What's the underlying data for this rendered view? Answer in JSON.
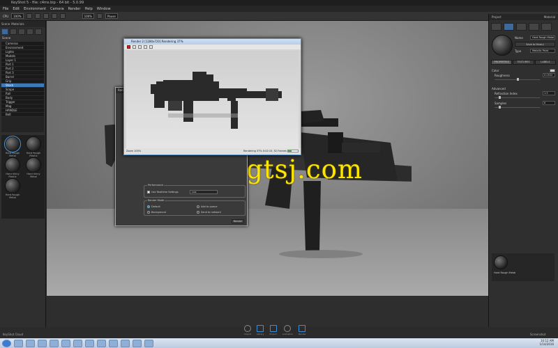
{
  "window": {
    "title": "KeyShot 5 - file: c4ms.bip - 64 bit - 5.0.99"
  },
  "menu": [
    "File",
    "Edit",
    "Environment",
    "Camera",
    "Render",
    "Help",
    "Window"
  ],
  "toolbar": {
    "cpu_label": "CPU",
    "cpu_value": "100%",
    "zoom": "100%",
    "render_mode": "Pause"
  },
  "left_panel": {
    "tabs": [
      "Scene",
      "Materials"
    ],
    "scene_tree_title": "Scene",
    "scene_items": [
      "Cameras",
      "Environment",
      "Lights",
      "Models",
      "Layer 1",
      "Part 1",
      "Part 2",
      "Part 3",
      "Barrel",
      "Grip",
      "Stock",
      "Scope",
      "Rail",
      "Body",
      "Trigger",
      "Mag",
      "HANDLE",
      "Bolt"
    ],
    "selected_index": 10,
    "materials": [
      {
        "name": "Hard Rough Metal",
        "selected": true
      },
      {
        "name": "Hard Rough Plastic",
        "selected": false
      },
      {
        "name": "Hard Shiny Plastic",
        "selected": false
      },
      {
        "name": "Hard Shiny Metal",
        "selected": false
      },
      {
        "name": "Hard Rough Metal",
        "selected": false
      }
    ]
  },
  "render_dialog": {
    "title": "Render 2 [1280x720] Rendering 37%",
    "status_left": "Zoom 100%",
    "status_right": "Rendering 37% 0:02:15, 52 Frames",
    "progress": 0.37
  },
  "back_dialog": {
    "title": "Render",
    "performance_group": "Performance",
    "checkbox_label": "Use Realtime Settings",
    "field_value": "Low",
    "render_mode_group": "Render Mode",
    "radio_options": [
      {
        "label": "Default",
        "on": true
      },
      {
        "label": "Background",
        "on": false
      },
      {
        "label": "Add to queue",
        "on": false
      },
      {
        "label": "Send to network",
        "on": false
      }
    ],
    "ok_button": "Render"
  },
  "watermark": "www.cgtsj.com",
  "right_panel": {
    "tabs": [
      "Project",
      "Material"
    ],
    "icon_labels": [
      "Scene",
      "Material",
      "Environment",
      "Camera",
      "Settings"
    ],
    "name_label": "Name",
    "name_value": "Hard Rough Metal",
    "save_button": "Save to library",
    "type_label": "Type",
    "type_value": "Metallic Paint",
    "seg_tabs": [
      "PROPERTIES",
      "TEXTURES",
      "LABELS"
    ],
    "color_label": "Color",
    "roughness_label": "Roughness",
    "roughness_value": "0.0532",
    "advanced_label": "Advanced",
    "refraction_label": "Refraction Index",
    "refraction_value": "1.5",
    "samples_label": "Samples",
    "samples_value": "8",
    "preview_label": "Hard Rough Metal"
  },
  "bottom_tools": [
    "Import",
    "Library",
    "Project",
    "Animation",
    "Render"
  ],
  "bottom_left": "KeyShot Cloud",
  "bottom_right": "Screenshot",
  "clock": {
    "time": "10:12 AM",
    "date": "1/14/2016"
  },
  "colors": {
    "accent": "#3e79b8",
    "watermark": "#ffe600",
    "progress": "#3bbb3b"
  }
}
